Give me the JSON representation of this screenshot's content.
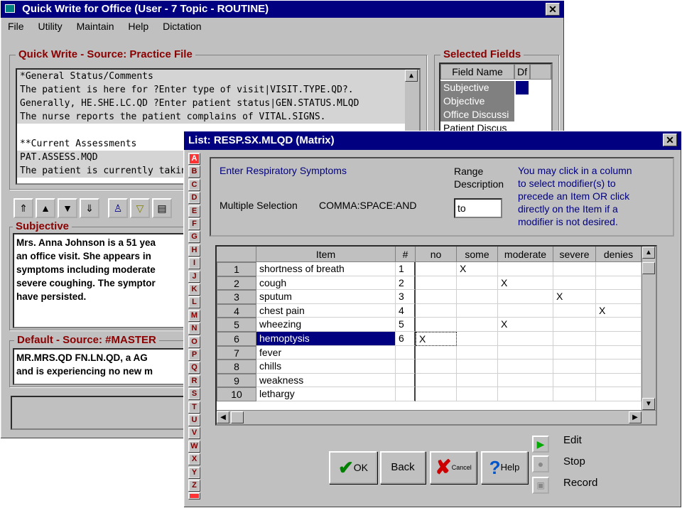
{
  "main_window": {
    "title": "Quick Write for Office   (User - 7   Topic - ROUTINE)",
    "close": "✕",
    "menu": [
      "File",
      "Utility",
      "Maintain",
      "Help",
      "Dictation"
    ],
    "source_label": "Quick Write - Source: Practice File",
    "lines": [
      "*General Status/Comments",
      "The patient is here for ?Enter type of visit|VISIT.TYPE.QD?.",
      "Generally, HE.SHE.LC.QD ?Enter patient status|GEN.STATUS.MLQD",
      "The nurse reports the patient complains of VITAL.SIGNS.",
      "",
      "**Current Assessments",
      "PAT.ASSESS.MQD",
      "The patient is currently taking"
    ],
    "selected_fields_label": "Selected Fields",
    "field_name_header": "Field Name",
    "df_header": "Df",
    "fields": [
      "Subjective",
      "Objective",
      "Office Discussi",
      "Patient Discus"
    ],
    "toolbar_icons": [
      "⇑",
      "▲",
      "▼",
      "⇓",
      "♙",
      "▽",
      "▤"
    ],
    "subjective_label": "Subjective",
    "subjective_text": "Mrs. Anna Johnson is a 51 yea an office visit. She appears in symptoms including moderate severe coughing. The symptor have persisted.",
    "subjective_lines": [
      "Mrs. Anna Johnson is a 51 yea",
      "an office visit. She appears in",
      "symptoms including moderate",
      "severe coughing. The symptor",
      "have persisted."
    ],
    "default_label": "Default - Source: #MASTER",
    "default_lines": [
      "MR.MRS.QD FN.LN.QD, a AG",
      "and is experiencing no new m"
    ]
  },
  "dialog": {
    "title": "List: RESP.SX.MLQD   (Matrix)",
    "close": "✕",
    "alphabet": [
      "A",
      "B",
      "C",
      "D",
      "E",
      "F",
      "G",
      "H",
      "I",
      "J",
      "K",
      "L",
      "M",
      "N",
      "O",
      "P",
      "Q",
      "R",
      "S",
      "T",
      "U",
      "V",
      "W",
      "X",
      "Y",
      "Z"
    ],
    "active_letter": "A",
    "prompt": "Enter Respiratory Symptoms",
    "multiple_selection_label": "Multiple Selection",
    "multiple_selection_value": "COMMA:SPACE:AND",
    "range_label_1": "Range",
    "range_label_2": "Description",
    "range_value": "to",
    "hint_lines": [
      "You may click in a column",
      "to select modifier(s) to",
      "precede an Item OR click",
      "directly on the Item if a",
      "modifier is not desired."
    ],
    "columns": [
      "",
      "Item",
      "#",
      "no",
      "some",
      "moderate",
      "severe",
      "denies"
    ],
    "rows": [
      {
        "n": "1",
        "item": "shortness of breath",
        "num": "1",
        "marks": [
          "",
          "X",
          "",
          "",
          ""
        ]
      },
      {
        "n": "2",
        "item": "cough",
        "num": "2",
        "marks": [
          "",
          "",
          "X",
          "",
          ""
        ]
      },
      {
        "n": "3",
        "item": "sputum",
        "num": "3",
        "marks": [
          "",
          "",
          "",
          "X",
          ""
        ]
      },
      {
        "n": "4",
        "item": "chest pain",
        "num": "4",
        "marks": [
          "",
          "",
          "",
          "",
          "X"
        ]
      },
      {
        "n": "5",
        "item": "wheezing",
        "num": "5",
        "marks": [
          "",
          "",
          "X",
          "",
          ""
        ]
      },
      {
        "n": "6",
        "item": "hemoptysis",
        "num": "6",
        "marks": [
          "X",
          "",
          "",
          "",
          ""
        ],
        "selected": true
      },
      {
        "n": "7",
        "item": "fever",
        "num": "",
        "marks": [
          "",
          "",
          "",
          "",
          ""
        ]
      },
      {
        "n": "8",
        "item": "chills",
        "num": "",
        "marks": [
          "",
          "",
          "",
          "",
          ""
        ]
      },
      {
        "n": "9",
        "item": "weakness",
        "num": "",
        "marks": [
          "",
          "",
          "",
          "",
          ""
        ]
      },
      {
        "n": "10",
        "item": "lethargy",
        "num": "",
        "marks": [
          "",
          "",
          "",
          "",
          ""
        ]
      }
    ],
    "buttons": {
      "ok": "OK",
      "back": "Back",
      "cancel": "Cancel",
      "help": "Help"
    },
    "controls": {
      "edit": "Edit",
      "stop": "Stop",
      "record": "Record"
    },
    "colors": {
      "title_bar": "#000080",
      "selected_row": "#000080",
      "label_red": "#8b0000",
      "hint_blue": "#000080"
    }
  }
}
